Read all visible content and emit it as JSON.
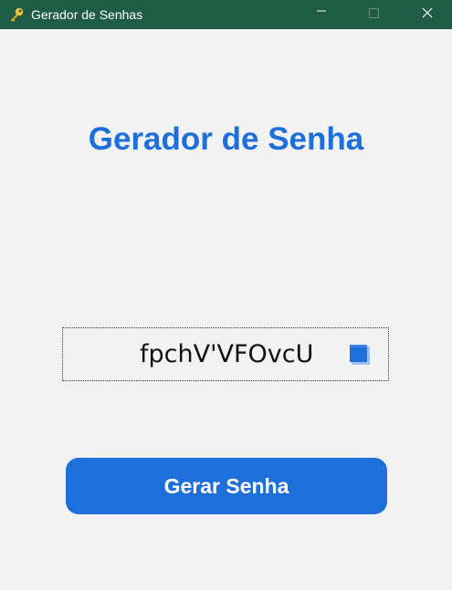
{
  "window": {
    "title": "Gerador de Senhas",
    "icon": "key-icon",
    "controls": [
      "minimize-icon",
      "maximize-icon",
      "close-icon"
    ]
  },
  "main": {
    "heading": "Gerador de Senha",
    "password": "fpchV'VFOvcU",
    "copy_icon": "copy-icon",
    "generate_label": "Gerar Senha"
  },
  "colors": {
    "titlebar": "#1f5c46",
    "accent": "#1e6fd9",
    "background": "#f2f2f2"
  }
}
